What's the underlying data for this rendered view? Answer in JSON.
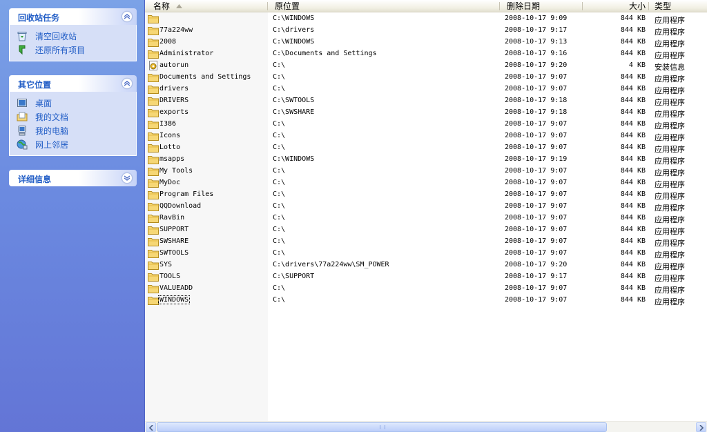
{
  "taskpane": {
    "recycle_tasks": {
      "title": "回收站任务",
      "items": [
        {
          "label": "清空回收站",
          "icon": "empty-recycle-bin-icon"
        },
        {
          "label": "还原所有项目",
          "icon": "restore-items-icon"
        }
      ]
    },
    "other_places": {
      "title": "其它位置",
      "items": [
        {
          "label": "桌面",
          "icon": "desktop-icon"
        },
        {
          "label": "我的文档",
          "icon": "my-documents-icon"
        },
        {
          "label": "我的电脑",
          "icon": "my-computer-icon"
        },
        {
          "label": "网上邻居",
          "icon": "network-places-icon"
        }
      ]
    },
    "details": {
      "title": "详细信息"
    }
  },
  "columns": {
    "name": "名称",
    "original_location": "原位置",
    "date_deleted": "删除日期",
    "size": "大小",
    "type": "类型"
  },
  "files": [
    {
      "name": "",
      "orig": "C:\\WINDOWS",
      "date": "2008-10-17 9:09",
      "size": "844 KB",
      "type": "应用程序",
      "icon": "folder-icon"
    },
    {
      "name": "77a224ww",
      "orig": "C:\\drivers",
      "date": "2008-10-17 9:17",
      "size": "844 KB",
      "type": "应用程序",
      "icon": "folder-icon"
    },
    {
      "name": "2008",
      "orig": "C:\\WINDOWS",
      "date": "2008-10-17 9:13",
      "size": "844 KB",
      "type": "应用程序",
      "icon": "folder-icon"
    },
    {
      "name": "Administrator",
      "orig": "C:\\Documents and Settings",
      "date": "2008-10-17 9:16",
      "size": "844 KB",
      "type": "应用程序",
      "icon": "folder-icon"
    },
    {
      "name": "autorun",
      "orig": "C:\\",
      "date": "2008-10-17 9:20",
      "size": "4 KB",
      "type": "安装信息",
      "icon": "setup-info-icon"
    },
    {
      "name": "Documents and Settings",
      "orig": "C:\\",
      "date": "2008-10-17 9:07",
      "size": "844 KB",
      "type": "应用程序",
      "icon": "folder-icon"
    },
    {
      "name": "drivers",
      "orig": "C:\\",
      "date": "2008-10-17 9:07",
      "size": "844 KB",
      "type": "应用程序",
      "icon": "folder-icon"
    },
    {
      "name": "DRIVERS",
      "orig": "C:\\SWTOOLS",
      "date": "2008-10-17 9:18",
      "size": "844 KB",
      "type": "应用程序",
      "icon": "folder-icon"
    },
    {
      "name": "exports",
      "orig": "C:\\SWSHARE",
      "date": "2008-10-17 9:18",
      "size": "844 KB",
      "type": "应用程序",
      "icon": "folder-icon"
    },
    {
      "name": "I386",
      "orig": "C:\\",
      "date": "2008-10-17 9:07",
      "size": "844 KB",
      "type": "应用程序",
      "icon": "folder-icon"
    },
    {
      "name": "Icons",
      "orig": "C:\\",
      "date": "2008-10-17 9:07",
      "size": "844 KB",
      "type": "应用程序",
      "icon": "folder-icon"
    },
    {
      "name": "Lotto",
      "orig": "C:\\",
      "date": "2008-10-17 9:07",
      "size": "844 KB",
      "type": "应用程序",
      "icon": "folder-icon"
    },
    {
      "name": "msapps",
      "orig": "C:\\WINDOWS",
      "date": "2008-10-17 9:19",
      "size": "844 KB",
      "type": "应用程序",
      "icon": "folder-icon"
    },
    {
      "name": "My Tools",
      "orig": "C:\\",
      "date": "2008-10-17 9:07",
      "size": "844 KB",
      "type": "应用程序",
      "icon": "folder-icon"
    },
    {
      "name": "MyDoc",
      "orig": "C:\\",
      "date": "2008-10-17 9:07",
      "size": "844 KB",
      "type": "应用程序",
      "icon": "folder-icon"
    },
    {
      "name": "Program Files",
      "orig": "C:\\",
      "date": "2008-10-17 9:07",
      "size": "844 KB",
      "type": "应用程序",
      "icon": "folder-icon"
    },
    {
      "name": "QQDownload",
      "orig": "C:\\",
      "date": "2008-10-17 9:07",
      "size": "844 KB",
      "type": "应用程序",
      "icon": "folder-icon"
    },
    {
      "name": "RavBin",
      "orig": "C:\\",
      "date": "2008-10-17 9:07",
      "size": "844 KB",
      "type": "应用程序",
      "icon": "folder-icon"
    },
    {
      "name": "SUPPORT",
      "orig": "C:\\",
      "date": "2008-10-17 9:07",
      "size": "844 KB",
      "type": "应用程序",
      "icon": "folder-icon"
    },
    {
      "name": "SWSHARE",
      "orig": "C:\\",
      "date": "2008-10-17 9:07",
      "size": "844 KB",
      "type": "应用程序",
      "icon": "folder-icon"
    },
    {
      "name": "SWTOOLS",
      "orig": "C:\\",
      "date": "2008-10-17 9:07",
      "size": "844 KB",
      "type": "应用程序",
      "icon": "folder-icon"
    },
    {
      "name": "SYS",
      "orig": "C:\\drivers\\77a224ww\\SM_POWER",
      "date": "2008-10-17 9:20",
      "size": "844 KB",
      "type": "应用程序",
      "icon": "folder-icon"
    },
    {
      "name": "TOOLS",
      "orig": "C:\\SUPPORT",
      "date": "2008-10-17 9:17",
      "size": "844 KB",
      "type": "应用程序",
      "icon": "folder-icon"
    },
    {
      "name": "VALUEADD",
      "orig": "C:\\",
      "date": "2008-10-17 9:07",
      "size": "844 KB",
      "type": "应用程序",
      "icon": "folder-icon"
    },
    {
      "name": "WINDOWS",
      "orig": "C:\\",
      "date": "2008-10-17 9:07",
      "size": "844 KB",
      "type": "应用程序",
      "icon": "folder-icon",
      "focused": true
    }
  ],
  "colors": {
    "taskpane_top": "#7ba2e7",
    "taskpane_bottom": "#6375d6",
    "panel_title": "#215dc6",
    "panel_body": "#d6dff7",
    "sorted_column": "#f7f7f7"
  }
}
